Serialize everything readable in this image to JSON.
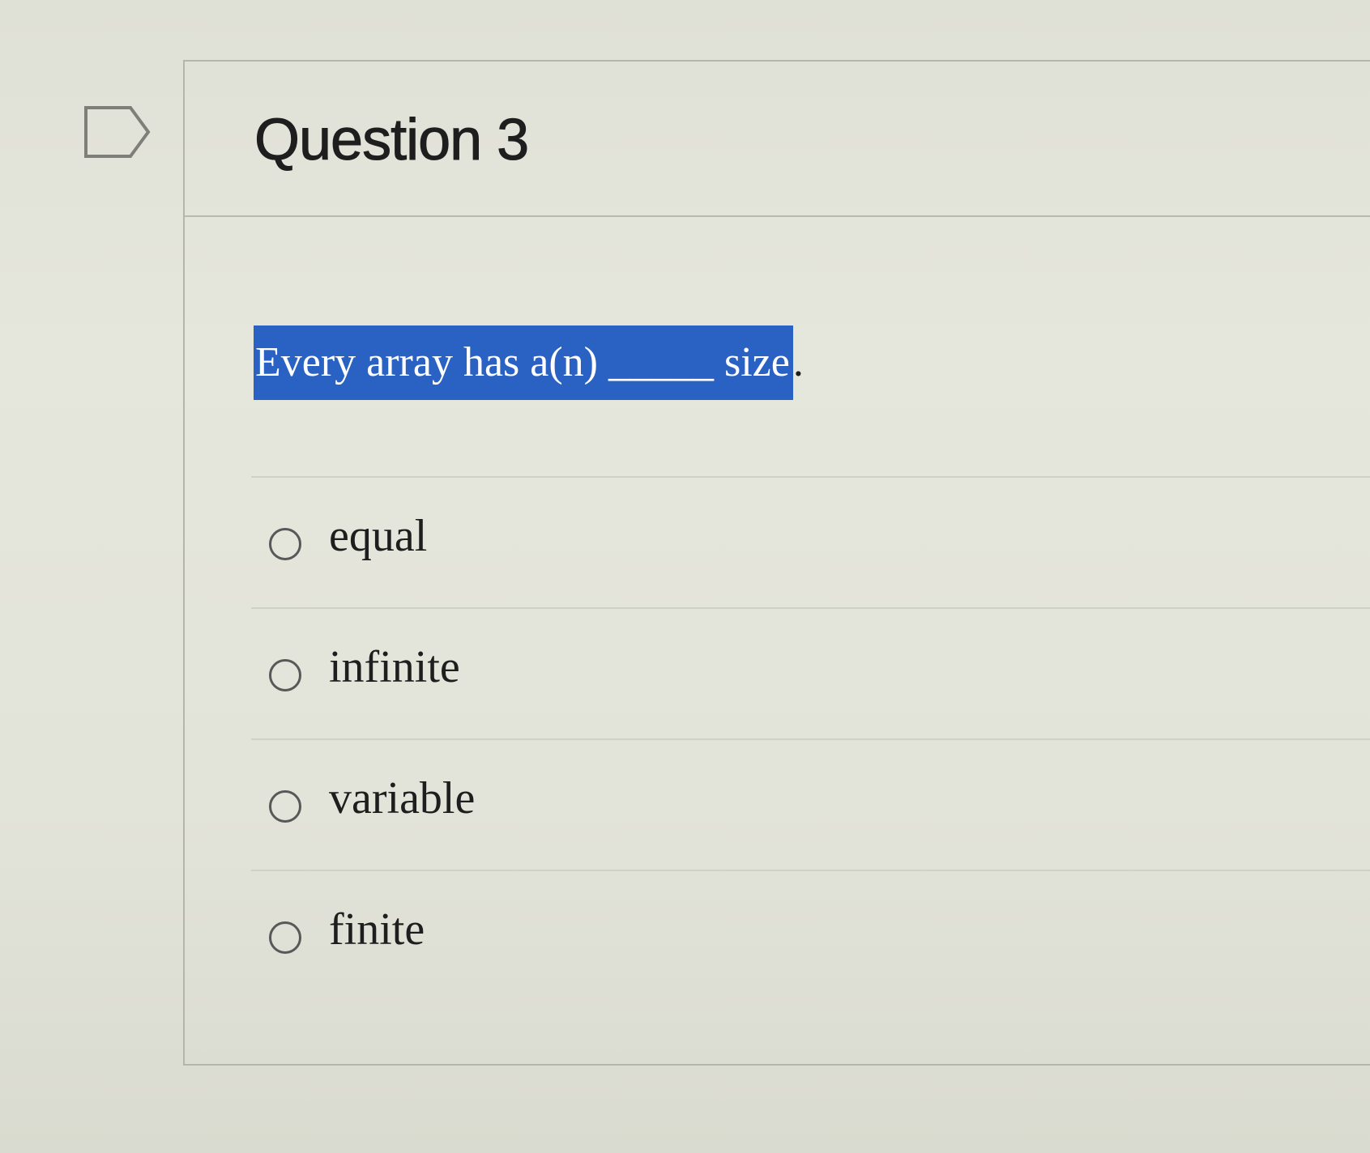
{
  "question": {
    "title": "Question 3",
    "text": "Every array has a(n) _____ size",
    "text_end": ".",
    "highlight_color": "#2a62c4"
  },
  "flag_icon": "flag-outline-icon",
  "answers": [
    {
      "label": "equal",
      "selected": false
    },
    {
      "label": "infinite",
      "selected": false
    },
    {
      "label": "variable",
      "selected": false
    },
    {
      "label": "finite",
      "selected": false
    }
  ]
}
